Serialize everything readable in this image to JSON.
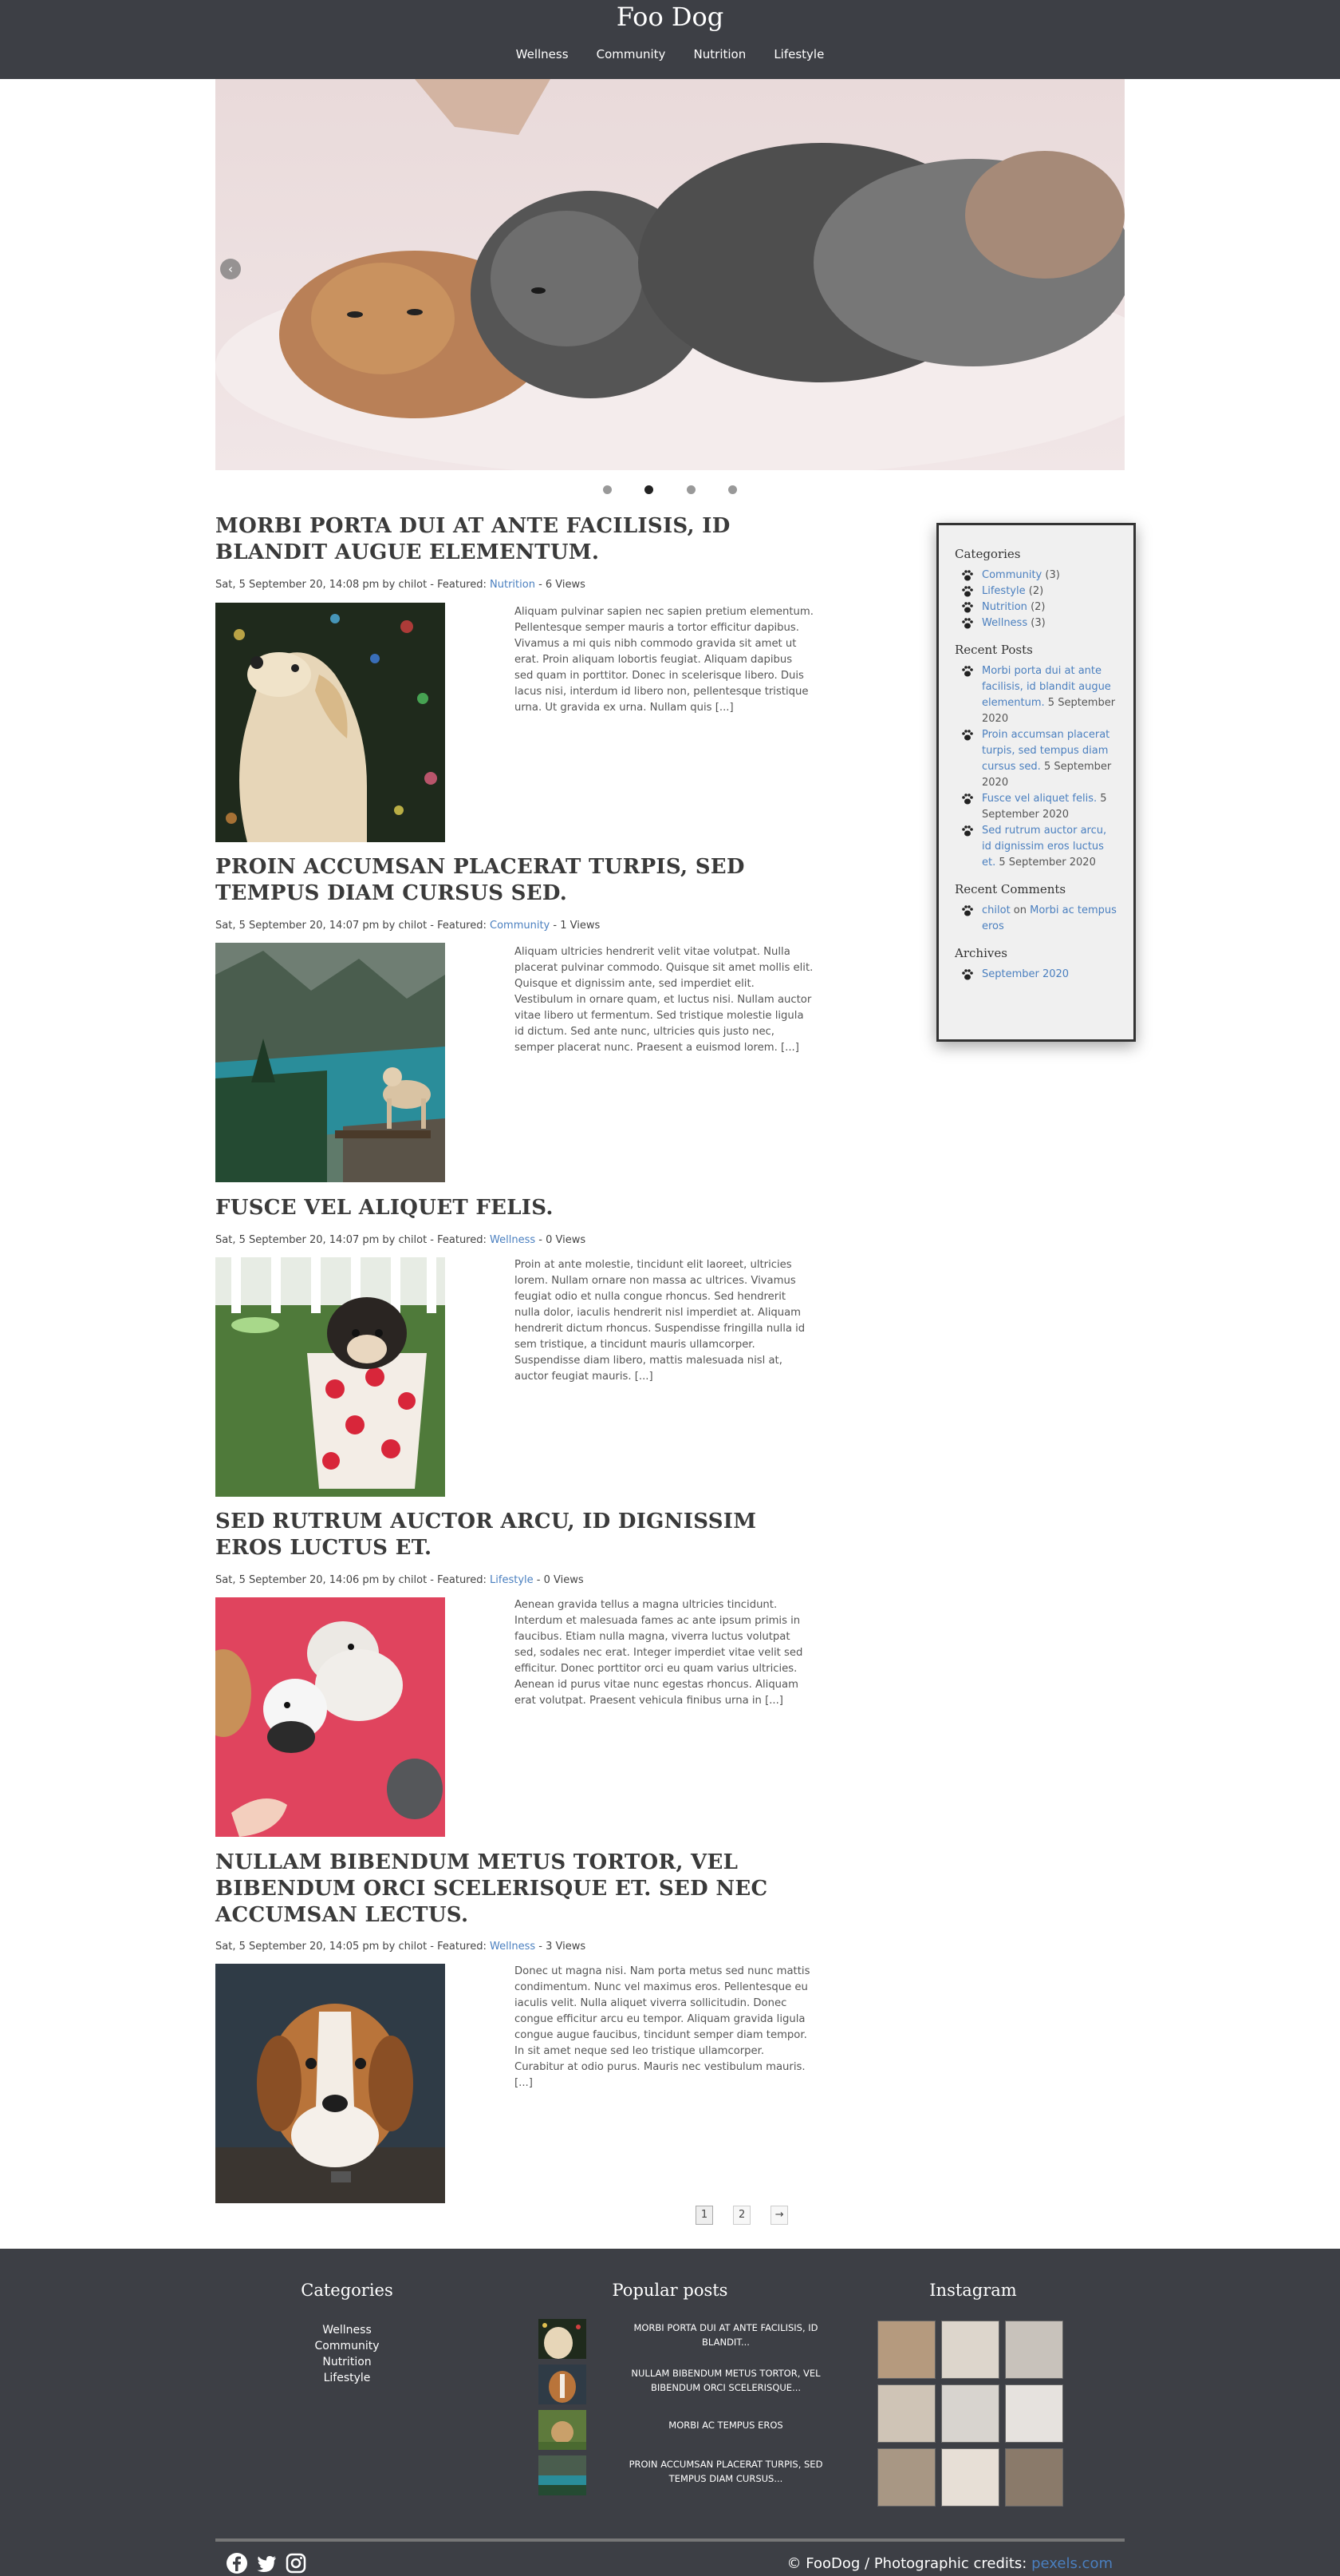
{
  "site": {
    "title": "Foo Dog"
  },
  "nav": {
    "items": [
      "Wellness",
      "Community",
      "Nutrition",
      "Lifestyle"
    ]
  },
  "slider": {
    "arrow_glyph": "‹",
    "slide_count": 4,
    "active_index": 1
  },
  "posts": [
    {
      "title": "Morbi porta dui at ante facilisis, id blandit augue elementum.",
      "meta_prefix": "Sat, 5 September 20, 14:08 pm by chilot - Featured: ",
      "category": "Nutrition",
      "meta_suffix": " - 6 Views",
      "excerpt": "Aliquam pulvinar sapien nec sapien pretium elementum. Pellentesque semper mauris a tortor efficitur dapibus. Vivamus a mi quis nibh commodo gravida sit amet ut erat. Proin aliquam lobortis feugiat. Aliquam dapibus sed quam in porttitor. Donec in scelerisque libero. Duis lacus nisi, interdum id libero non, pellentesque tristique urna. Ut gravida ex urna. Nullam quis [...]"
    },
    {
      "title": "Proin accumsan placerat turpis, sed tempus diam cursus sed.",
      "meta_prefix": "Sat, 5 September 20, 14:07 pm by chilot - Featured: ",
      "category": "Community",
      "meta_suffix": " - 1 Views",
      "excerpt": "Aliquam ultricies hendrerit velit vitae volutpat. Nulla placerat pulvinar commodo. Quisque sit amet mollis elit. Quisque et dignissim ante, sed imperdiet elit. Vestibulum in ornare quam, et luctus nisi. Nullam auctor vitae libero ut fermentum. Sed tristique molestie ligula id dictum. Sed ante nunc, ultricies quis justo nec, semper placerat nunc. Praesent a euismod lorem. [...]"
    },
    {
      "title": "Fusce vel aliquet felis.",
      "meta_prefix": "Sat, 5 September 20, 14:07 pm by chilot - Featured: ",
      "category": "Wellness",
      "meta_suffix": " - 0 Views",
      "excerpt": "Proin at ante molestie, tincidunt elit laoreet, ultricies lorem. Nullam ornare non massa ac ultrices. Vivamus feugiat odio et nulla congue rhoncus. Sed hendrerit nulla dolor, iaculis hendrerit nisl imperdiet at. Aliquam hendrerit dictum rhoncus. Suspendisse fringilla nulla id sem tristique, a tincidunt mauris ullamcorper. Suspendisse diam libero, mattis malesuada nisl at, auctor feugiat mauris. [...]"
    },
    {
      "title": "Sed rutrum auctor arcu, id dignissim eros luctus et.",
      "meta_prefix": "Sat, 5 September 20, 14:06 pm by chilot - Featured: ",
      "category": "Lifestyle",
      "meta_suffix": " - 0 Views",
      "excerpt": "Aenean gravida tellus a magna ultricies tincidunt. Interdum et malesuada fames ac ante ipsum primis in faucibus. Etiam nulla magna, viverra luctus volutpat sed, sodales nec erat. Integer imperdiet vitae velit sed efficitur. Donec porttitor orci eu quam varius ultricies. Aenean id purus vitae nunc egestas rhoncus. Aliquam erat volutpat. Praesent vehicula finibus urna in [...]"
    },
    {
      "title": "Nullam bibendum metus tortor, vel bibendum orci scelerisque et. Sed nec accumsan lectus.",
      "meta_prefix": "Sat, 5 September 20, 14:05 pm by chilot - Featured: ",
      "category": "Wellness",
      "meta_suffix": " - 3 Views",
      "excerpt": "Donec ut magna nisi. Nam porta metus sed nunc mattis condimentum. Nunc vel maximus eros. Pellentesque eu iaculis velit. Nulla aliquet viverra sollicitudin. Donec congue efficitur arcu eu tempor. Aliquam gravida ligula congue augue faucibus, tincidunt semper diam tempor. In sit amet neque sed leo tristique ullamcorper. Curabitur at odio purus. Mauris nec vestibulum mauris. [...]"
    }
  ],
  "sidebar": {
    "categories_title": "Categories",
    "categories": [
      {
        "name": "Community",
        "count": "(3)"
      },
      {
        "name": "Lifestyle",
        "count": "(2)"
      },
      {
        "name": "Nutrition",
        "count": "(2)"
      },
      {
        "name": "Wellness",
        "count": "(3)"
      }
    ],
    "recent_posts_title": "Recent Posts",
    "recent_posts": [
      {
        "link": "Morbi porta dui at ante facilisis, id blandit augue elementum.",
        "date": " 5 September 2020"
      },
      {
        "link": "Proin accumsan placerat turpis, sed tempus diam cursus sed.",
        "date": " 5 September 2020"
      },
      {
        "link": "Fusce vel aliquet felis.",
        "date": " 5 September 2020"
      },
      {
        "link": "Sed rutrum auctor arcu, id dignissim eros luctus et.",
        "date": " 5 September 2020"
      }
    ],
    "recent_comments_title": "Recent Comments",
    "recent_comments": [
      {
        "author": "chilot",
        "on": " on ",
        "post": "Morbi ac tempus eros"
      }
    ],
    "archives_title": "Archives",
    "archives": [
      "September 2020"
    ]
  },
  "pagination": {
    "pages": [
      "1",
      "2"
    ],
    "next": "→"
  },
  "footer": {
    "categories_title": "Categories",
    "categories": [
      "Wellness",
      "Community",
      "Nutrition",
      "Lifestyle"
    ],
    "popular_title": "Popular posts",
    "popular": [
      "Morbi porta dui at ante facilisis, id blandit...",
      "Nullam bibendum metus tortor, vel bibendum orci scelerisque...",
      "Morbi ac tempus eros",
      "Proin accumsan placerat turpis, sed tempus diam cursus..."
    ],
    "instagram_title": "Instagram",
    "credits_prefix": "© FooDog / Photographic credits: ",
    "credits_link": "pexels.com"
  },
  "colors": {
    "header_bg": "#3d3f45",
    "link": "#4a7fbf",
    "footer_bg": "#3d3f45"
  }
}
